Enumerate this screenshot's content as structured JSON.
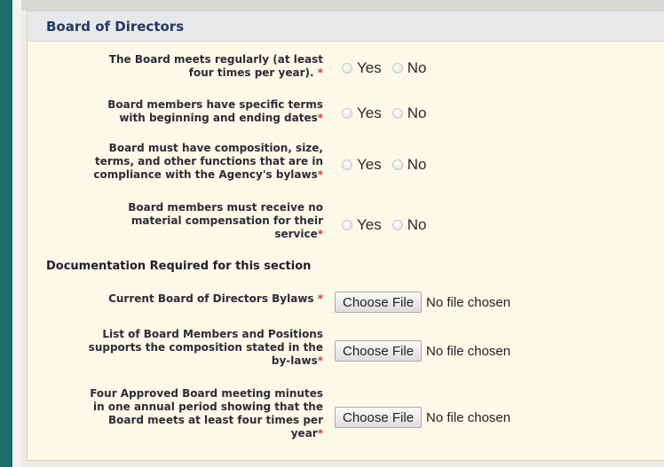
{
  "section": {
    "title": "Board of Directors"
  },
  "questions": [
    {
      "lines": [
        "The Board meets regularly (at least",
        "four times per year)."
      ],
      "required_mark": " *",
      "options": [
        "Yes",
        "No"
      ]
    },
    {
      "lines": [
        "Board members have specific terms",
        "with beginning and ending dates"
      ],
      "required_mark": "*",
      "options": [
        "Yes",
        "No"
      ]
    },
    {
      "lines": [
        "Board must have composition, size,",
        "terms, and other functions that are in",
        "compliance with the Agency's bylaws"
      ],
      "required_mark": "*",
      "options": [
        "Yes",
        "No"
      ]
    },
    {
      "lines": [
        "Board members must receive no",
        "material compensation for their",
        "service"
      ],
      "required_mark": "*",
      "options": [
        "Yes",
        "No"
      ]
    }
  ],
  "documentation": {
    "heading": "Documentation Required for this section",
    "items": [
      {
        "lines": [
          "Current Board of Directors Bylaws"
        ],
        "required_mark": " *",
        "button_label": "Choose File",
        "status": "No file chosen"
      },
      {
        "lines": [
          "List of Board Members and Positions",
          "supports the composition stated in the",
          "by-laws"
        ],
        "required_mark": "*",
        "button_label": "Choose File",
        "status": "No file chosen"
      },
      {
        "lines": [
          "Four Approved Board meeting minutes",
          "in one annual period showing that the",
          "Board meets at least four times per",
          "year"
        ],
        "required_mark": "*",
        "button_label": "Choose File",
        "status": "No file chosen"
      }
    ]
  },
  "colors": {
    "accent_bar": "#1b6e6c",
    "panel_bg": "#fdf9e8",
    "header_text": "#213a63",
    "required": "#d23a3a"
  }
}
